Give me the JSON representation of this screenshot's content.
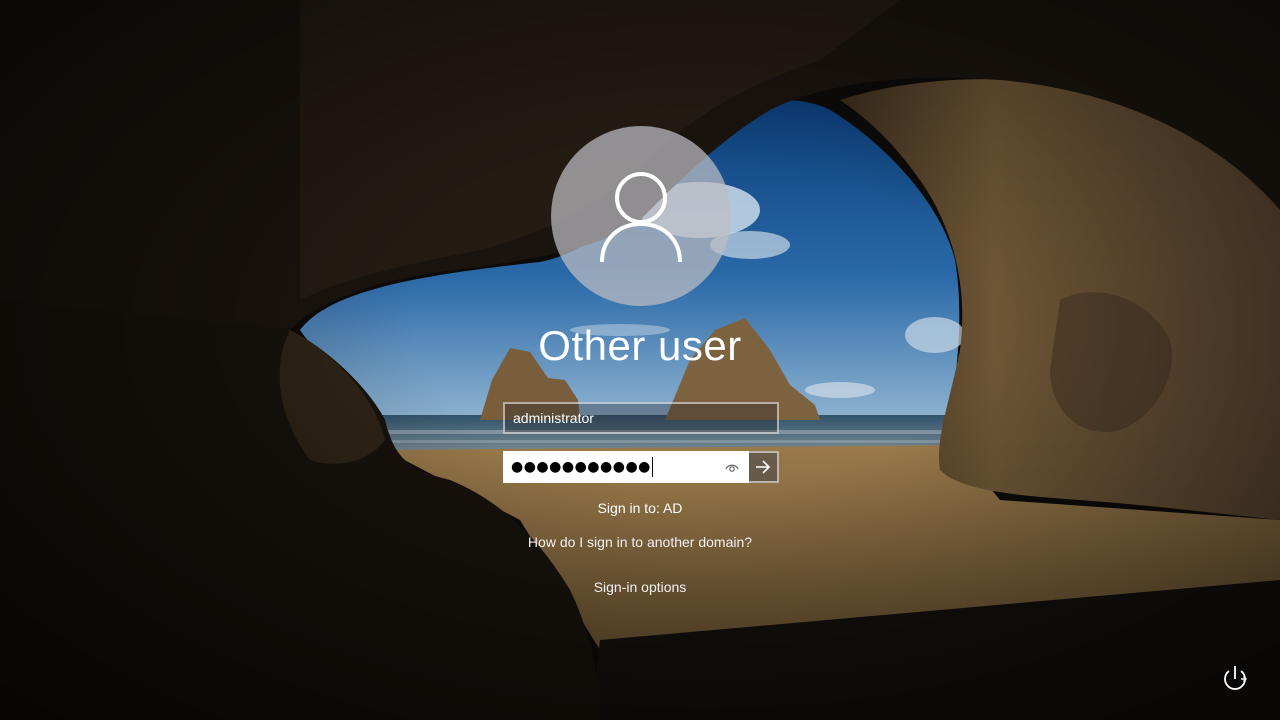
{
  "login": {
    "user_display_name": "Other user",
    "username_value": "administrator",
    "password_masked": "●●●●●●●●●●●",
    "sign_in_to": "Sign in to: AD",
    "domain_help_link": "How do I sign in to another domain?",
    "signin_options_link": "Sign-in options"
  },
  "icons": {
    "avatar": "user-silhouette-icon",
    "reveal_password": "eye-icon",
    "submit": "arrow-right-icon",
    "ease_of_access": "power-icon"
  },
  "colors": {
    "text": "#ffffff",
    "avatar_bg": "#bebec3",
    "field_border": "#ffffff"
  }
}
